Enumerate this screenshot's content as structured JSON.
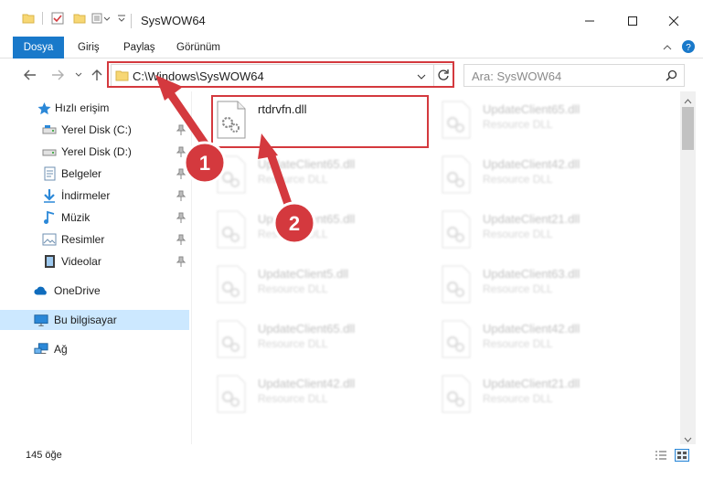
{
  "window": {
    "title": "SysWOW64"
  },
  "ribbon": {
    "tabs": [
      {
        "label": "Dosya"
      },
      {
        "label": "Giriş"
      },
      {
        "label": "Paylaş"
      },
      {
        "label": "Görünüm"
      }
    ]
  },
  "address": {
    "path": "C:\\Windows\\SysWOW64"
  },
  "search": {
    "placeholder": "Ara: SysWOW64"
  },
  "sidebar": {
    "items": [
      {
        "label": "Hızlı erişim",
        "icon": "star-icon",
        "pinned": false
      },
      {
        "label": "Yerel Disk (C:)",
        "icon": "drive-icon",
        "pinned": true
      },
      {
        "label": "Yerel Disk (D:)",
        "icon": "drive-icon",
        "pinned": true
      },
      {
        "label": "Belgeler",
        "icon": "documents-icon",
        "pinned": true
      },
      {
        "label": "İndirmeler",
        "icon": "download-icon",
        "pinned": true
      },
      {
        "label": "Müzik",
        "icon": "music-icon",
        "pinned": true
      },
      {
        "label": "Resimler",
        "icon": "pictures-icon",
        "pinned": true
      },
      {
        "label": "Videolar",
        "icon": "video-icon",
        "pinned": true
      },
      {
        "label": "OneDrive",
        "icon": "cloud-icon",
        "pinned": false
      },
      {
        "label": "Bu bilgisayar",
        "icon": "computer-icon",
        "pinned": false,
        "selected": true
      },
      {
        "label": "Ağ",
        "icon": "network-icon",
        "pinned": false
      }
    ]
  },
  "files": [
    {
      "name": "rtdrvfn.dll",
      "type": ""
    },
    {
      "name": "UpdateClient65.dll",
      "type": "Resource DLL"
    },
    {
      "name": "UpdateClient65.dll",
      "type": "Resource DLL"
    },
    {
      "name": "UpdateClient42.dll",
      "type": "Resource DLL"
    },
    {
      "name": "UpdateClient65.dll",
      "type": "Resource DLL"
    },
    {
      "name": "UpdateClient21.dll",
      "type": "Resource DLL"
    },
    {
      "name": "UpdateClient5.dll",
      "type": "Resource DLL"
    },
    {
      "name": "UpdateClient63.dll",
      "type": "Resource DLL"
    },
    {
      "name": "UpdateClient65.dll",
      "type": "Resource DLL"
    },
    {
      "name": "UpdateClient42.dll",
      "type": "Resource DLL"
    },
    {
      "name": "UpdateClient42.dll",
      "type": "Resource DLL"
    },
    {
      "name": "UpdateClient21.dll",
      "type": "Resource DLL"
    }
  ],
  "status": {
    "count_text": "145 öğe"
  },
  "annotations": {
    "step1": "1",
    "step2": "2",
    "color": "#d4393e"
  },
  "colors": {
    "accent": "#1979ca",
    "selection": "#cce8ff"
  }
}
